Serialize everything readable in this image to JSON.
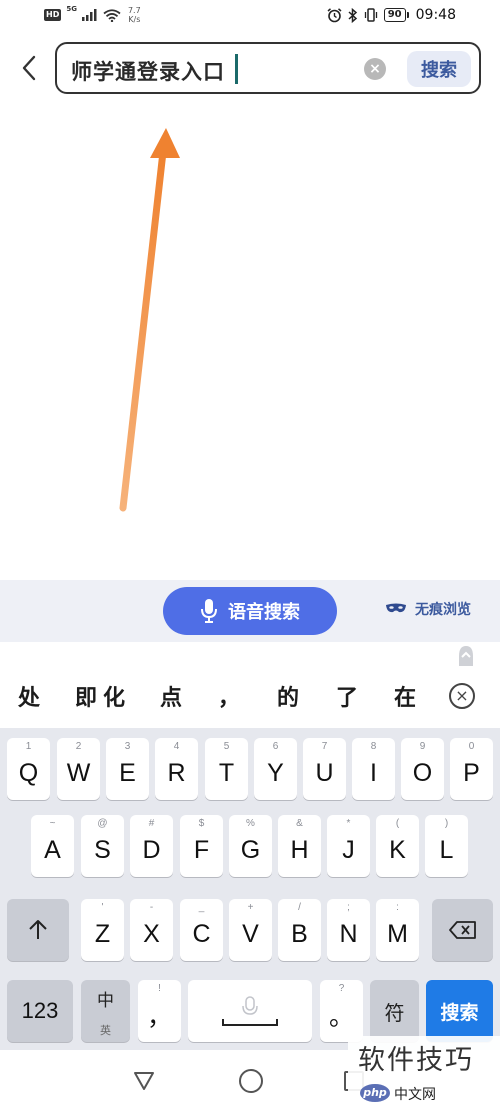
{
  "status_bar": {
    "hd_badge": "HD",
    "network": "5G",
    "speed_value": "7.7",
    "speed_unit": "K/s",
    "battery": "90",
    "time": "09:48"
  },
  "search": {
    "query": "师学通登录入口",
    "button_label": "搜索"
  },
  "voice": {
    "button_label": "语音搜索",
    "incognito_label": "无痕浏览"
  },
  "candidates": [
    "处",
    "即",
    "化",
    "点",
    "，",
    "的",
    "了",
    "在"
  ],
  "keyboard": {
    "row1": [
      {
        "main": "Q",
        "sub": "1"
      },
      {
        "main": "W",
        "sub": "2"
      },
      {
        "main": "E",
        "sub": "3"
      },
      {
        "main": "R",
        "sub": "4"
      },
      {
        "main": "T",
        "sub": "5"
      },
      {
        "main": "Y",
        "sub": "6"
      },
      {
        "main": "U",
        "sub": "7"
      },
      {
        "main": "I",
        "sub": "8"
      },
      {
        "main": "O",
        "sub": "9"
      },
      {
        "main": "P",
        "sub": "0"
      }
    ],
    "row2": [
      {
        "main": "A",
        "sub": "~"
      },
      {
        "main": "S",
        "sub": "@"
      },
      {
        "main": "D",
        "sub": "#"
      },
      {
        "main": "F",
        "sub": "$"
      },
      {
        "main": "G",
        "sub": "%"
      },
      {
        "main": "H",
        "sub": "&"
      },
      {
        "main": "J",
        "sub": "*"
      },
      {
        "main": "K",
        "sub": "("
      },
      {
        "main": "L",
        "sub": ")"
      }
    ],
    "row3": [
      {
        "main": "Z",
        "sub": "'"
      },
      {
        "main": "X",
        "sub": "-"
      },
      {
        "main": "C",
        "sub": "_"
      },
      {
        "main": "V",
        "sub": "+"
      },
      {
        "main": "B",
        "sub": "/"
      },
      {
        "main": "N",
        "sub": ";"
      },
      {
        "main": "M",
        "sub": ":"
      }
    ],
    "shift_icon": "shift-arrow-icon",
    "backspace_icon": "backspace-icon",
    "num_key": "123",
    "lang_key_top": "中",
    "lang_key_bottom": "英",
    "comma_key": "，",
    "comma_sub": "!",
    "period_key": "。",
    "period_sub": "?",
    "symbol_key": "符",
    "enter_key": "搜索"
  },
  "watermark": {
    "text": "软件技巧",
    "logo": "php",
    "sub": "中文网"
  },
  "colors": {
    "voice_button": "#4f6ee6",
    "enter_key": "#1f7be6",
    "search_button_bg": "#e7ebf6",
    "annotation_arrow": "#f0883a"
  }
}
